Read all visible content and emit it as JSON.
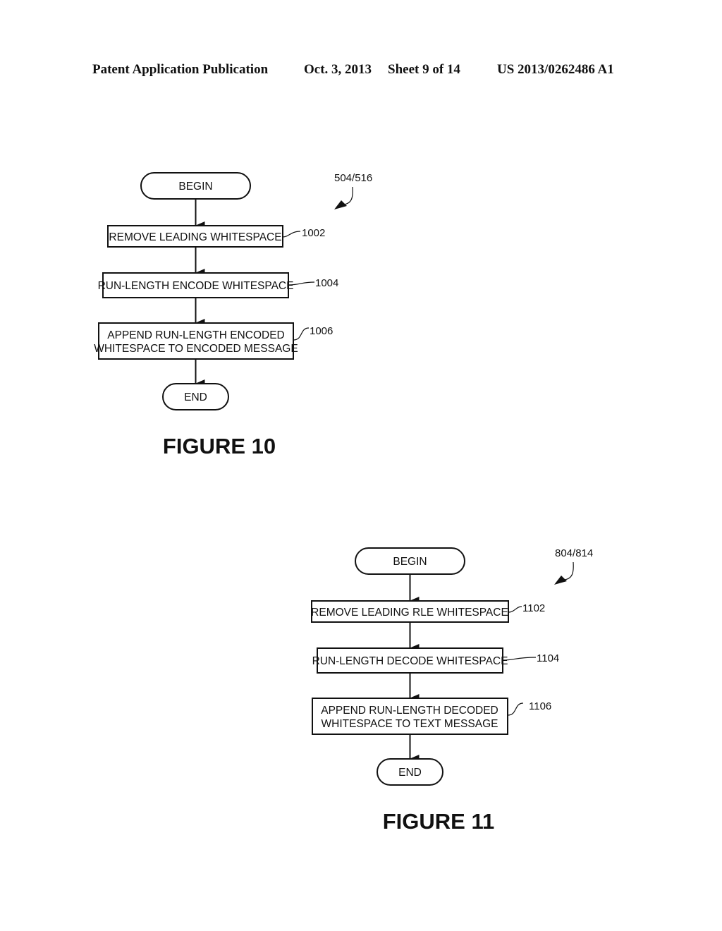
{
  "header": {
    "publication": "Patent Application Publication",
    "date": "Oct. 3, 2013",
    "sheet": "Sheet 9 of 14",
    "patent_number": "US 2013/0262486 A1"
  },
  "figure10": {
    "caption": "FIGURE 10",
    "reference": "504/516",
    "begin": "BEGIN",
    "end": "END",
    "steps": [
      {
        "ref": "1002",
        "lines": [
          "REMOVE LEADING WHITESPACE"
        ]
      },
      {
        "ref": "1004",
        "lines": [
          "RUN-LENGTH ENCODE WHITESPACE"
        ]
      },
      {
        "ref": "1006",
        "lines": [
          "APPEND RUN-LENGTH ENCODED",
          "WHITESPACE TO ENCODED MESSAGE"
        ]
      }
    ]
  },
  "figure11": {
    "caption": "FIGURE 11",
    "reference": "804/814",
    "begin": "BEGIN",
    "end": "END",
    "steps": [
      {
        "ref": "1102",
        "lines": [
          "REMOVE LEADING RLE WHITESPACE"
        ]
      },
      {
        "ref": "1104",
        "lines": [
          "RUN-LENGTH DECODE WHITESPACE"
        ]
      },
      {
        "ref": "1106",
        "lines": [
          "APPEND RUN-LENGTH DECODED",
          "WHITESPACE TO TEXT MESSAGE"
        ]
      }
    ]
  }
}
